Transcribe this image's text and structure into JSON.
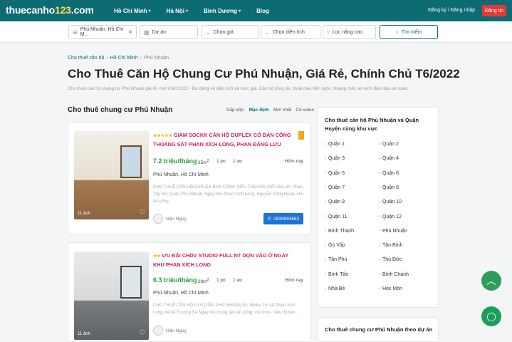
{
  "header": {
    "logo_main": "thuecanho",
    "logo_accent": "123",
    "logo_tld": ".com",
    "nav": [
      {
        "label": "Hồ Chí Minh",
        "has_dropdown": true
      },
      {
        "label": "Hà Nội",
        "has_dropdown": true
      },
      {
        "label": "Bình Dương",
        "has_dropdown": true
      },
      {
        "label": "Blog",
        "has_dropdown": false
      }
    ],
    "auth_label": "Đăng ký / Đăng nhập",
    "post_label": "Đăng tin",
    "colors": {
      "brand": "#0c6b73",
      "post": "#e53935"
    }
  },
  "search": {
    "location": "Phú Nhuận, Hồ Chí M...",
    "project": "Dự án",
    "price": "Chọn giá",
    "area": "Chọn diện tích",
    "advanced": "Lọc nâng cao",
    "button": "Tìm kiếm"
  },
  "breadcrumb": [
    "Cho thuê căn hộ",
    "Hồ Chí Minh",
    "Phú Nhuận"
  ],
  "page": {
    "title": "Cho Thuê Căn Hộ Chung Cư Phú Nhuận, Giá Rẻ, Chính Chủ T6/2022",
    "description": "Cho thuê căn hộ chung cư Phú Nhuận giá rẻ, mới nhất 2022 - Đa dạng về diện tích và mức giá. Căn hộ rộng rãi, thoải mái, tiện nghi, thoáng mát, an ninh đảm bảo an toàn."
  },
  "listing": {
    "heading": "Cho thuê chung cư Phú Nhuận",
    "sort_label": "Sắp xếp:",
    "sort_options": [
      "Mặc định",
      "Mới nhất",
      "Có video"
    ],
    "sort_active": "Mặc định",
    "items": [
      {
        "stars": "★★★★★",
        "title": "GIẢM SOCKK CĂN HỘ DUPLEX CÓ BAN CÔNG THOÁNG SÁT PHAN XÍCH LONG, PHAN ĐĂNG LƯU",
        "price": "7.2 triệu/tháng",
        "area": "35m",
        "area_sup": "2",
        "bedrooms": "1 pn",
        "bathrooms": "1 wc",
        "time": "Hôm nay",
        "location": "Phú Nhuận, Hồ Chí Minh",
        "snippet": "CHO THUÊ CĂN HỘ DUPLEX BAN CÔNG SIÊU THOÁNG MÁT Địa chỉ: Phan Tây Hồ, Quận Phú Nhuận. Ngay khu Phan Xích Long, Nguyễn Công Hoan, khu ăn uống...",
        "photo_count": "11 ảnh",
        "owner": "Hân Nguy",
        "phone": "0839993662"
      },
      {
        "stars": "★★",
        "title": "ƯU ĐÃI CHDV STUDIO FULL NT DỌN VÀO Ở NGAY KHU PHAN XÍCH LONG",
        "price": "6.3 triệu/tháng",
        "area": "28m",
        "area_sup": "2",
        "bedrooms": "1 pn",
        "bathrooms": "1 wc",
        "time": "Hôm nay",
        "location": "Phú Nhuận, Hồ Chí Minh",
        "snippet": "CHO THUÊ CĂN HỘ ƯU QUẬN PHÚ NHUẬN Đc: Nhiêu Tứ sát Phan Xích Long, bệ kề Trường Sa Ngay khu trung tâm ăn uống, vui chơi - siêu thị bên...",
        "photo_count": "11 ảnh",
        "owner": "Hân Nguy"
      }
    ]
  },
  "sidebar": {
    "title": "Cho thuê căn hộ Phú Nhuận và Quận Huyện cùng khu vực",
    "districts": [
      "Quận 1",
      "Quận 2",
      "Quận 3",
      "Quận 4",
      "Quận 5",
      "Quận 6",
      "Quận 7",
      "Quận 8",
      "Quận 9",
      "Quận 10",
      "Quận 11",
      "Quận 12",
      "Bình Thạnh",
      "Phú Nhuận",
      "Gò Vấp",
      "Tân Bình",
      "Tân Phú",
      "Thủ Đức",
      "Bình Tân",
      "Bình Chánh",
      "Nhà Bè",
      "Hóc Môn"
    ],
    "projects_title": "Cho thuê chung cư Phú Nhuận theo dự án"
  }
}
